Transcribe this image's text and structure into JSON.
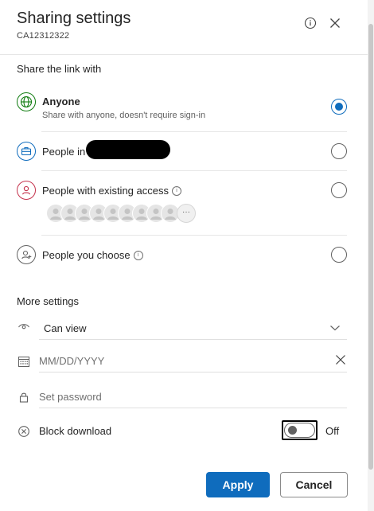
{
  "header": {
    "title": "Sharing settings",
    "subtitle": "CA12312322"
  },
  "share_section": {
    "title": "Share the link with",
    "options": [
      {
        "label": "Anyone",
        "description": "Share with anyone, doesn't require sign-in",
        "selected": true,
        "icon": "globe-icon"
      },
      {
        "label": "People in",
        "selected": false,
        "icon": "briefcase-icon"
      },
      {
        "label": "People with existing access",
        "selected": false,
        "icon": "person-icon"
      },
      {
        "label": "People you choose",
        "selected": false,
        "icon": "person-add-icon"
      }
    ],
    "more_avatars_label": "···"
  },
  "more_settings": {
    "title": "More settings",
    "permission_value": "Can view",
    "date_placeholder": "MM/DD/YYYY",
    "password_placeholder": "Set password",
    "block_download_label": "Block download",
    "block_download_state": "Off"
  },
  "footer": {
    "apply_label": "Apply",
    "cancel_label": "Cancel"
  },
  "colors": {
    "accent": "#0f6cbd",
    "globe": "#107c10",
    "briefcase": "#0f6cbd",
    "person_existing": "#c4314b"
  }
}
